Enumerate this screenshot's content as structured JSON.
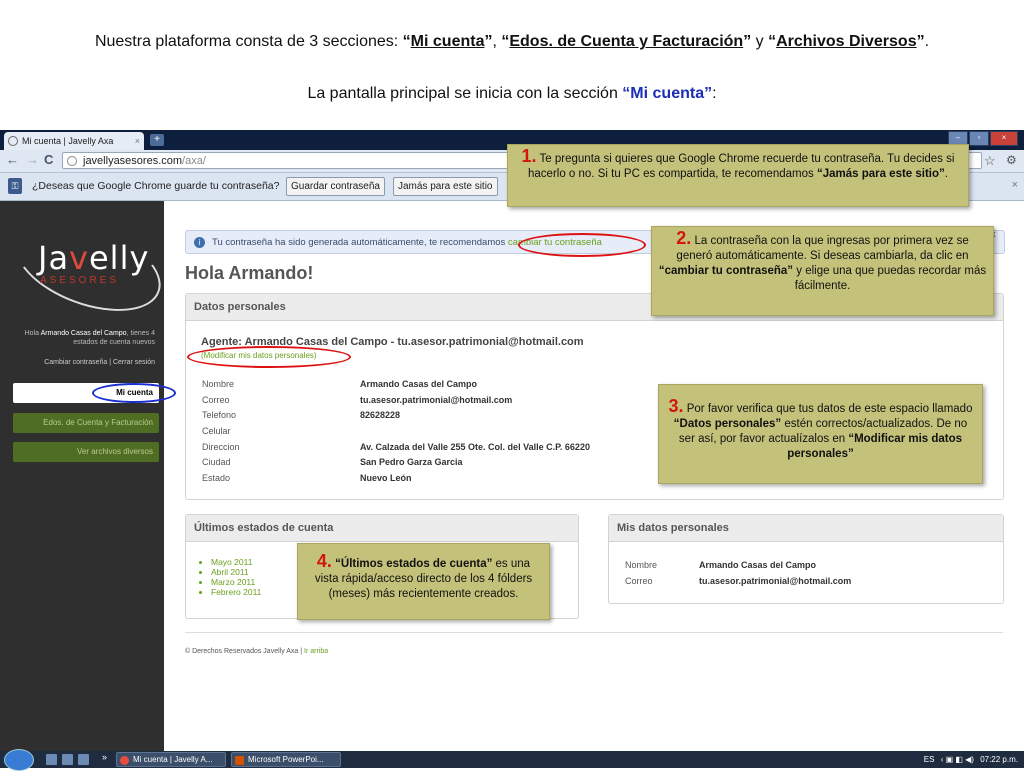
{
  "slide": {
    "line1_pre": "Nuestra plataforma consta de 3 secciones: ",
    "line1_s1": "Mi cuenta",
    "line1_s2": "Edos. de Cuenta y Facturación",
    "line1_and": " y ",
    "line1_s3": "Archivos Diversos",
    "line2_pre": "La pantalla principal se inicia con la sección ",
    "line2_highlight": "“Mi cuenta”",
    "line2_post": ":"
  },
  "browser": {
    "tab_title": "Mi cuenta | Javelly Axa",
    "tab_close": "×",
    "new_tab": "+",
    "back": "←",
    "forward": "→",
    "reload": "C",
    "url_domain": "javellyasesores.com",
    "url_path": "/axa/",
    "star_icon": "☆",
    "wrench_icon": "🔧",
    "colors": {
      "tabbar": "#0e1f3d",
      "toolbar": "#dfe7f3"
    }
  },
  "infobar": {
    "message": "¿Deseas que Google Chrome guarde tu contraseña?",
    "save_label": "Guardar contraseña",
    "never_label": "Jamás para este sitio",
    "close": "×"
  },
  "sidebar": {
    "logo_word_a": "Ja",
    "logo_word_b": "v",
    "logo_word_c": "elly",
    "logo_sub": "ASESORES",
    "greet_hola": "Hola",
    "greet_name": "Armando Casas del Campo",
    "greet_rest": ", tienes 4 estados de cuenta nuevos",
    "link_change": "Cambiar contraseña",
    "link_sep": " | ",
    "link_logout": "Cerrar sesión",
    "nav": [
      {
        "label": "Mi cuenta"
      },
      {
        "label": "Edos. de Cuenta y Facturación"
      },
      {
        "label": "Ver archivos diversos"
      }
    ]
  },
  "main": {
    "notice_text": "Tu contraseña ha sido generada automáticamente, te recomendamos ",
    "notice_link": "cambiar tu contraseña",
    "notice_close": "x",
    "greeting": "Hola Armando!",
    "datos": {
      "title": "Datos personales",
      "agent": "Agente: Armando Casas del Campo - tu.asesor.patrimonial@hotmail.com",
      "modify_link": "(Modificar mis datos personales)",
      "rows": [
        {
          "label": "Nombre",
          "value": "Armando Casas del Campo"
        },
        {
          "label": "Correo",
          "value": "tu.asesor.patrimonial@hotmail.com"
        },
        {
          "label": "Telefono",
          "value": "82628228"
        },
        {
          "label": "Celular",
          "value": ""
        },
        {
          "label": "Direccion",
          "value": "Av. Calzada del Valle 255 Ote. Col. del Valle C.P. 66220"
        },
        {
          "label": "Ciudad",
          "value": "San Pedro Garza Garcia"
        },
        {
          "label": "Estado",
          "value": "Nuevo León"
        }
      ]
    },
    "ultimos": {
      "title": "Últimos estados de cuenta",
      "months": [
        "Mayo 2011",
        "Abril 2011",
        "Marzo 2011",
        "Febrero 2011"
      ]
    },
    "mis_datos": {
      "title": "Mis datos personales",
      "rows": [
        {
          "label": "Nombre",
          "value": "Armando Casas del Campo"
        },
        {
          "label": "Correo",
          "value": "tu.asesor.patrimonial@hotmail.com"
        }
      ]
    },
    "footer_text": "© Derechos Reservados Javelly Axa | ",
    "footer_link": "Ir arriba"
  },
  "callouts": {
    "c1_num": "1.",
    "c1_text": " Te pregunta si quieres que Google Chrome recuerde tu contraseña. Tu decides si hacerlo o no. Si tu PC es compartida, te recomendamos ",
    "c1_bold": "“Jamás para este sitio”",
    "c1_end": ".",
    "c2_num": "2.",
    "c2_text": " La contraseña con la que ingresas por primera vez se generó automáticamente. Si deseas cambiarla, da clic en ",
    "c2_bold": "“cambiar tu contraseña”",
    "c2_end": " y elige una que puedas recordar más fácilmente.",
    "c3_num": "3.",
    "c3_text": " Por favor verifica que tus datos de este espacio llamado ",
    "c3_bold": "“Datos personales”",
    "c3_mid": " estén correctos/actualizados. De no ser así, por favor actualízalos en ",
    "c3_bold2": "“Modificar mis datos personales”",
    "c4_num": "4.",
    "c4_bold": " “Últimos estados de cuenta”",
    "c4_text": " es una vista rápida/acceso directo de los 4 fólders (meses) más recientemente creados.",
    "color": "#c4c27a"
  },
  "taskbar": {
    "task1": "Mi cuenta | Javelly A...",
    "task2": "Microsoft PowerPoi...",
    "more": "»",
    "lang": "ES",
    "time": "07:22 p.m."
  }
}
